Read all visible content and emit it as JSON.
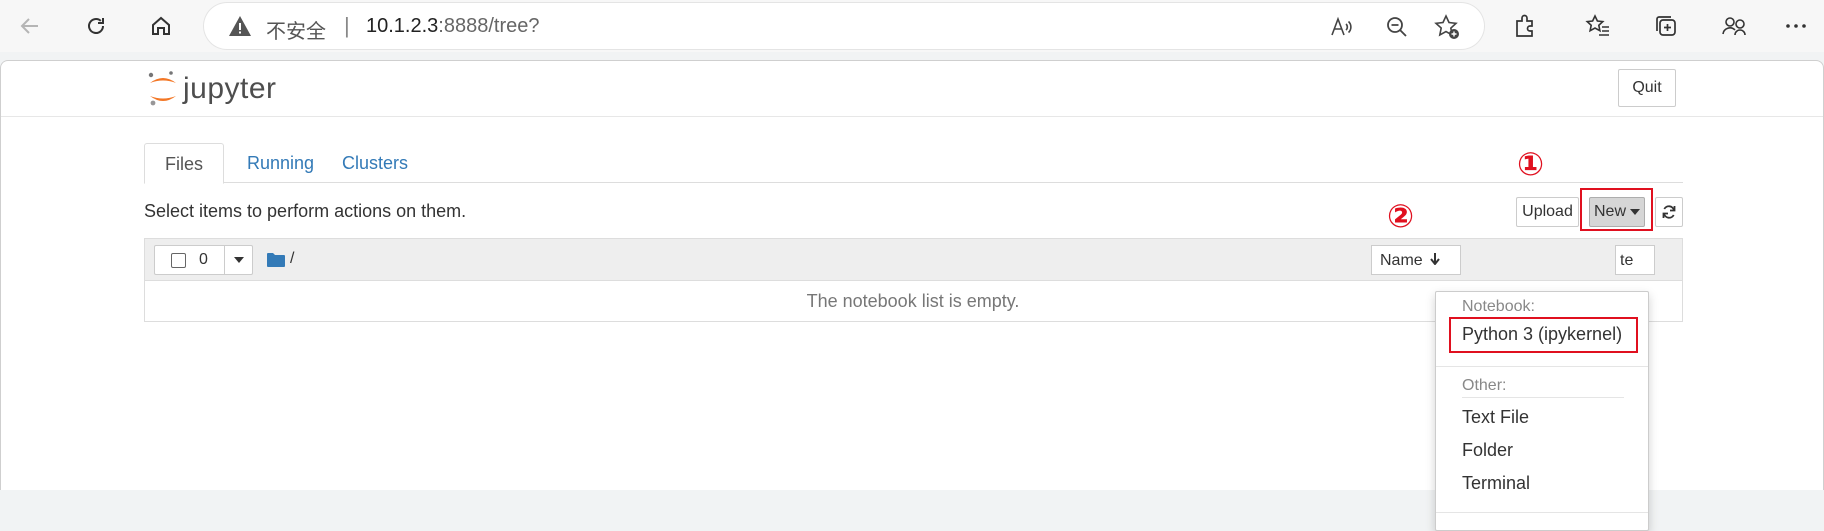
{
  "browser": {
    "insecure_label": "不安全",
    "separator": "|",
    "url_host": "10.1.2.3",
    "url_rest": ":8888/tree?"
  },
  "app": {
    "logo_text": "jupyter",
    "quit_label": "Quit"
  },
  "tabs": [
    {
      "label": "Files",
      "active": true
    },
    {
      "label": "Running",
      "active": false
    },
    {
      "label": "Clusters",
      "active": false
    }
  ],
  "toolbar": {
    "hint": "Select items to perform actions on them.",
    "upload_label": "Upload",
    "new_label": "New"
  },
  "file_list": {
    "selected_count": "0",
    "breadcrumb": "/",
    "sort_name_label": "Name",
    "sort_date_fragment": "te",
    "empty_message": "The notebook list is empty."
  },
  "new_menu": {
    "notebook_header": "Notebook:",
    "kernel_item": "Python 3 (ipykernel)",
    "other_header": "Other:",
    "other_items": [
      "Text File",
      "Folder",
      "Terminal"
    ]
  },
  "annotations": {
    "step1": "①",
    "step2": "②"
  },
  "colors": {
    "link": "#337ab7",
    "annotation_red": "#e0101f",
    "jupyter_orange": "#f37726"
  }
}
